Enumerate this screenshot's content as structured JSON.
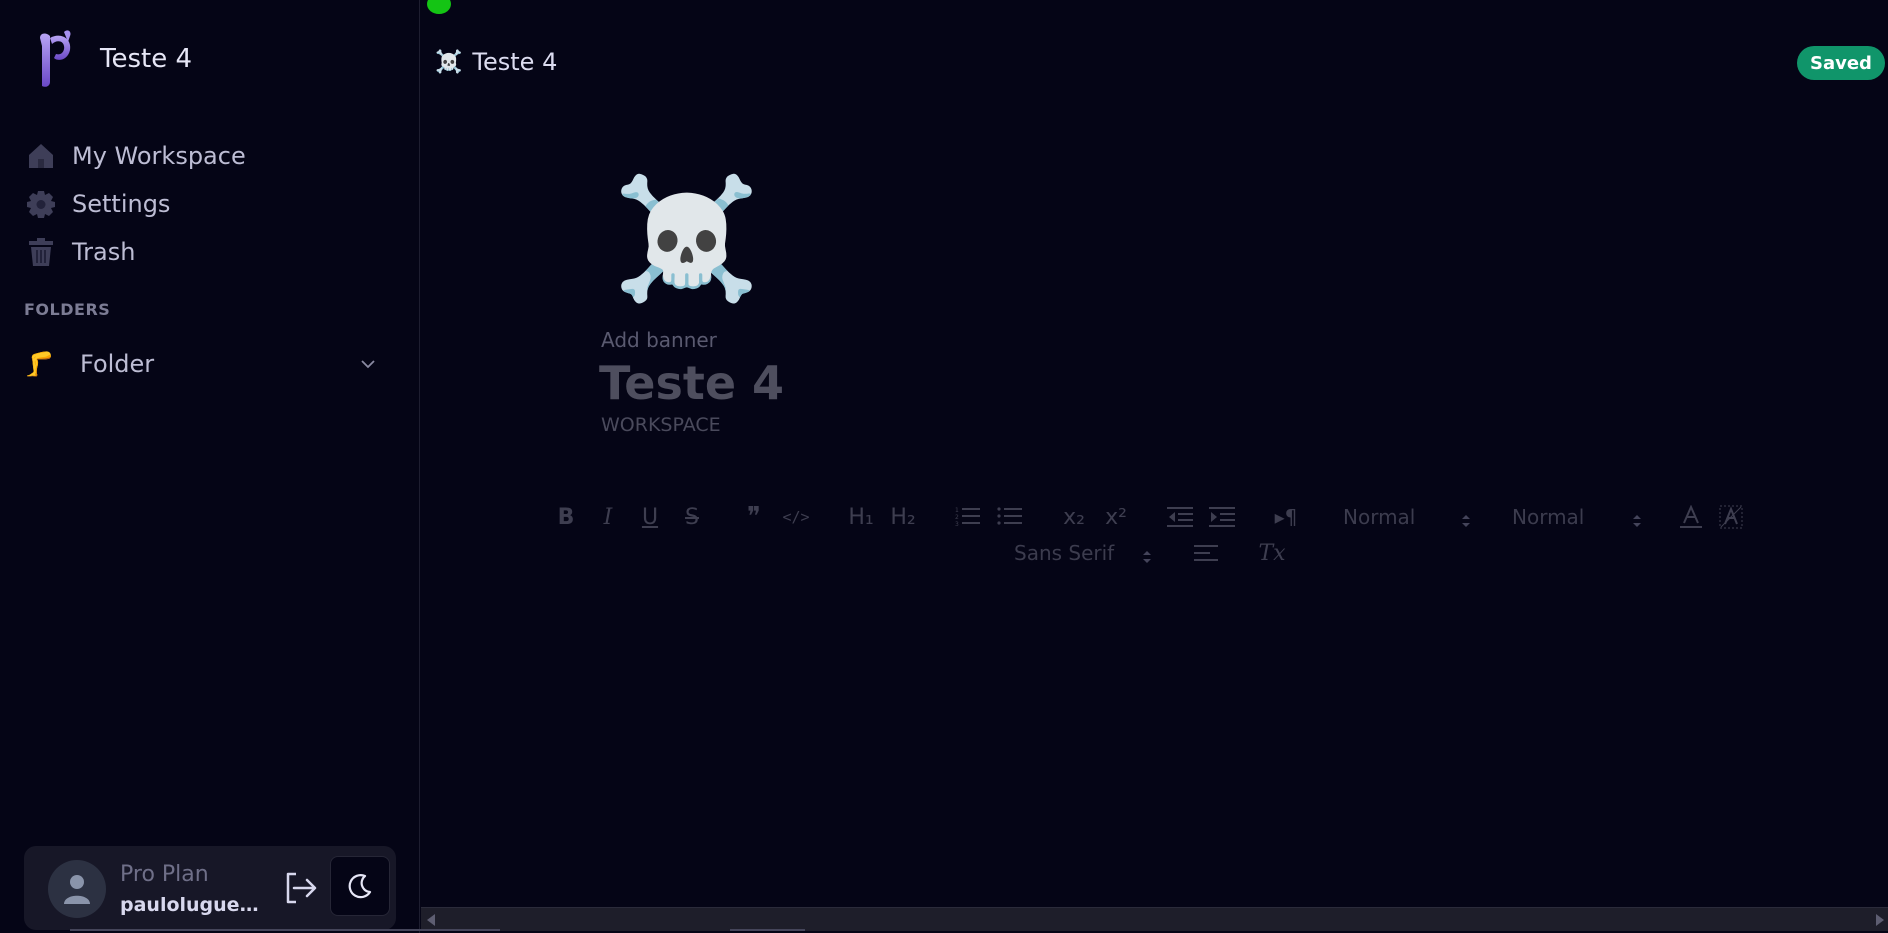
{
  "app": {
    "workspace_name": "Teste 4",
    "logo_icon": "cypress-logo-icon"
  },
  "sidebar": {
    "items": [
      {
        "label": "My Workspace",
        "icon": "home-icon"
      },
      {
        "label": "Settings",
        "icon": "gear-icon"
      },
      {
        "label": "Trash",
        "icon": "trash-icon"
      }
    ],
    "folders_heading": "FOLDERS",
    "folders": [
      {
        "label": "Folder",
        "emoji": "🦵",
        "icon": "chevron-down-icon"
      }
    ]
  },
  "user": {
    "plan": "Pro Plan",
    "username": "paululuguendaluu@gmail.com",
    "username_display": "pauloluguenda...",
    "logout_icon": "logout-icon",
    "theme_icon": "moon-icon"
  },
  "header": {
    "breadcrumb_emoji": "☠️",
    "breadcrumb_title": "Teste 4",
    "status": "Saved",
    "status_color": "#10956a"
  },
  "document": {
    "icon": "☠️",
    "add_banner": "Add banner",
    "title": "Teste 4",
    "subtitle": "WORKSPACE"
  },
  "toolbar": {
    "bold": "B",
    "italic": "I",
    "underline": "U",
    "strike": "S",
    "quote": "❞",
    "code": "</>",
    "h1": "H₁",
    "h2": "H₂",
    "subscript": "x₂",
    "superscript": "x²",
    "direction": "▸¶",
    "size_select": "Normal",
    "header_select": "Normal",
    "font_select": "Sans Serif",
    "clean": "Tx"
  },
  "colors": {
    "background": "#050516",
    "accent": "#7c5cd6",
    "saved_badge": "#10956a",
    "status_dot": "#14c414"
  }
}
